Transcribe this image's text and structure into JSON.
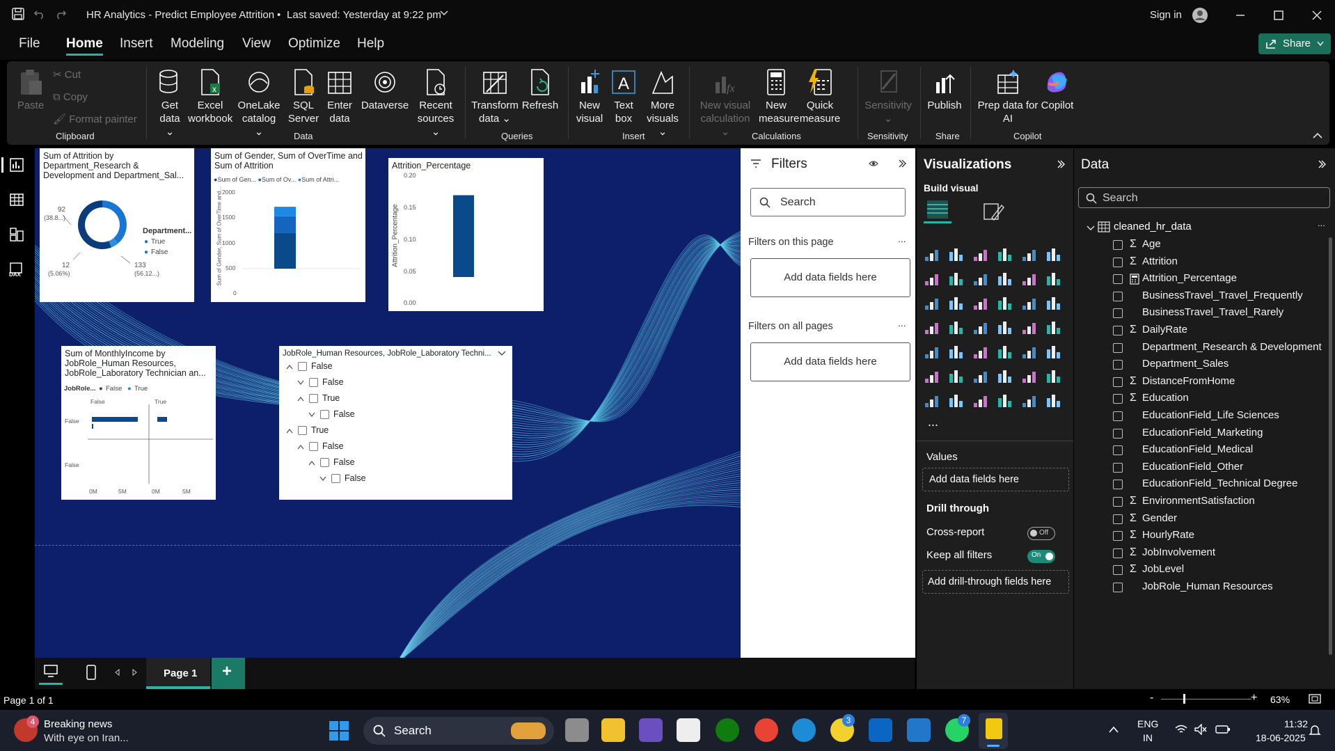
{
  "window": {
    "title": "HR Analytics - Predict Employee Attrition",
    "save_status": "Last saved: Yesterday at 9:22 pm",
    "sign_in": "Sign in",
    "share": "Share"
  },
  "menu": [
    "File",
    "Home",
    "Insert",
    "Modeling",
    "View",
    "Optimize",
    "Help"
  ],
  "ribbon": {
    "clipboard": {
      "paste": "Paste",
      "cut": "Cut",
      "copy": "Copy",
      "format_painter": "Format painter",
      "group": "Clipboard"
    },
    "data": {
      "get_data": "Get",
      "get_data2": "data",
      "excel": "Excel",
      "excel2": "workbook",
      "onelake": "OneLake",
      "onelake2": "catalog",
      "sql": "SQL",
      "sql2": "Server",
      "enter": "Enter",
      "enter2": "data",
      "dataverse": "Dataverse",
      "recent": "Recent",
      "recent2": "sources",
      "group": "Data"
    },
    "queries": {
      "transform": "Transform",
      "transform2": "data",
      "refresh": "Refresh",
      "group": "Queries"
    },
    "insert": {
      "new_visual": "New",
      "new_visual2": "visual",
      "text_box": "Text",
      "text_box2": "box",
      "more": "More",
      "more2": "visuals",
      "group": "Insert"
    },
    "calculations": {
      "nvc": "New visual",
      "nvc2": "calculation",
      "nm": "New",
      "nm2": "measure",
      "qm": "Quick",
      "qm2": "measure",
      "group": "Calculations"
    },
    "sensitivity": {
      "label": "Sensitivity",
      "group": "Sensitivity"
    },
    "share": {
      "publish": "Publish",
      "group": "Share"
    },
    "copilot": {
      "prep": "Prep data for",
      "prep2": "AI",
      "copilot": "Copilot",
      "group": "Copilot"
    }
  },
  "visuals": {
    "donut": {
      "title": "Sum of Attrition by Department_Research & Development and Department_Sal...",
      "legend_title": "Department...",
      "legend": [
        "True",
        "False"
      ],
      "label_a": "92",
      "label_a2": "(38.8...)",
      "label_b": "12",
      "label_b2": "(5.06%)",
      "label_c": "133",
      "label_c2": "(56.12...)"
    },
    "stacked": {
      "title": "Sum of Gender, Sum of OverTime and Sum of Attrition",
      "legend": [
        "Sum of Gen...",
        "Sum of Ov...",
        "Sum of Attri..."
      ],
      "ylabel": "Sum of Gender, Sum of OverTime and...",
      "ticks": [
        "2000",
        "1500",
        "1000",
        "500",
        "0"
      ]
    },
    "attrition_pct": {
      "title": "Attrition_Percentage",
      "ylabel": "Attrition_Percentage",
      "ticks": [
        "0.20",
        "0.15",
        "0.10",
        "0.05",
        "0.00"
      ]
    },
    "income": {
      "title": "Sum of MonthlyIncome by JobRole_Human Resources, JobRole_Laboratory Technician an...",
      "legend_title": "JobRole...",
      "legend": [
        "False",
        "True"
      ],
      "col_a": "False",
      "col_b": "True",
      "row_a": "False",
      "row_b": "False",
      "ticks": [
        "0M",
        "5M",
        "0M",
        "5M"
      ]
    },
    "slicer": {
      "title": "JobRole_Human Resources, JobRole_Laboratory Techni...",
      "items": [
        {
          "label": "False",
          "level": 0,
          "exp": "collapse"
        },
        {
          "label": "False",
          "level": 1,
          "exp": "expand"
        },
        {
          "label": "True",
          "level": 1,
          "exp": "collapse"
        },
        {
          "label": "False",
          "level": 2,
          "exp": "expand"
        },
        {
          "label": "True",
          "level": 0,
          "exp": "collapse"
        },
        {
          "label": "False",
          "level": 1,
          "exp": "collapse"
        },
        {
          "label": "False",
          "level": 2,
          "exp": "collapse"
        },
        {
          "label": "False",
          "level": 3,
          "exp": "expand"
        }
      ]
    }
  },
  "chart_data": [
    {
      "type": "pie",
      "title": "Sum of Attrition by Department_Research & Development and Department_Sal...",
      "legend_title": "Department...",
      "categories": [
        "True",
        "False"
      ],
      "labels": [
        "92 (38.8...)",
        "12 (5.06%)",
        "133 (56.12...)"
      ],
      "values": [
        92,
        12,
        133
      ]
    },
    {
      "type": "bar",
      "title": "Sum of Gender, Sum of OverTime and Sum of Attrition",
      "series": [
        {
          "name": "Sum of Gen...",
          "values": [
            880
          ]
        },
        {
          "name": "Sum of Ov...",
          "values": [
            416
          ]
        },
        {
          "name": "Sum of Attri...",
          "values": [
            237
          ]
        }
      ],
      "ylabel": "Sum of Gender, Sum of OverTime and...",
      "ylim": [
        0,
        2000
      ]
    },
    {
      "type": "bar",
      "title": "Attrition_Percentage",
      "values": [
        0.161
      ],
      "ylabel": "Attrition_Percentage",
      "ylim": [
        0,
        0.2
      ]
    }
  ],
  "filters": {
    "title": "Filters",
    "search": "Search",
    "on_page": "Filters on this page",
    "add_here": "Add data fields here",
    "on_all": "Filters on all pages",
    "add_here2": "Add data fields here",
    "more": "..."
  },
  "viz_pane": {
    "title": "Visualizations",
    "build": "Build visual",
    "more": "...",
    "values": "Values",
    "add_values": "Add data fields here",
    "drill": "Drill through",
    "cross": "Cross-report",
    "cross_state": "Off",
    "keep": "Keep all filters",
    "keep_state": "On",
    "add_drill": "Add drill-through fields here"
  },
  "data_pane": {
    "title": "Data",
    "search": "Search",
    "table": "cleaned_hr_data",
    "more": "...",
    "fields": [
      {
        "name": "Age",
        "icon": "sigma"
      },
      {
        "name": "Attrition",
        "icon": "sigma"
      },
      {
        "name": "Attrition_Percentage",
        "icon": "calc"
      },
      {
        "name": "BusinessTravel_Travel_Frequently",
        "icon": ""
      },
      {
        "name": "BusinessTravel_Travel_Rarely",
        "icon": ""
      },
      {
        "name": "DailyRate",
        "icon": "sigma"
      },
      {
        "name": "Department_Research & Development",
        "icon": ""
      },
      {
        "name": "Department_Sales",
        "icon": ""
      },
      {
        "name": "DistanceFromHome",
        "icon": "sigma"
      },
      {
        "name": "Education",
        "icon": "sigma"
      },
      {
        "name": "EducationField_Life Sciences",
        "icon": ""
      },
      {
        "name": "EducationField_Marketing",
        "icon": ""
      },
      {
        "name": "EducationField_Medical",
        "icon": ""
      },
      {
        "name": "EducationField_Other",
        "icon": ""
      },
      {
        "name": "EducationField_Technical Degree",
        "icon": ""
      },
      {
        "name": "EnvironmentSatisfaction",
        "icon": "sigma"
      },
      {
        "name": "Gender",
        "icon": "sigma"
      },
      {
        "name": "HourlyRate",
        "icon": "sigma"
      },
      {
        "name": "JobInvolvement",
        "icon": "sigma"
      },
      {
        "name": "JobLevel",
        "icon": "sigma"
      },
      {
        "name": "JobRole_Human Resources",
        "icon": ""
      }
    ]
  },
  "page_tabs": {
    "page": "Page 1",
    "add": "+"
  },
  "status": {
    "page_of": "Page 1 of 1",
    "zoom": "63%"
  },
  "taskbar": {
    "news_title": "Breaking news",
    "news_sub": "With eye on Iran...",
    "news_badge": "4",
    "search": "Search",
    "lang1": "ENG",
    "lang2": "IN",
    "time": "11:32",
    "date": "18-06-2025",
    "badge_a": "3",
    "badge_b": "7"
  },
  "colors": {
    "accent": "#2ab3a6",
    "canvas": "#0d1f6b",
    "bar_dark": "#0a4a8a",
    "bar_mid": "#1565c0",
    "bar_light": "#1e88e5",
    "donut_dark": "#0a3d7a",
    "donut_light": "#1976d2"
  }
}
